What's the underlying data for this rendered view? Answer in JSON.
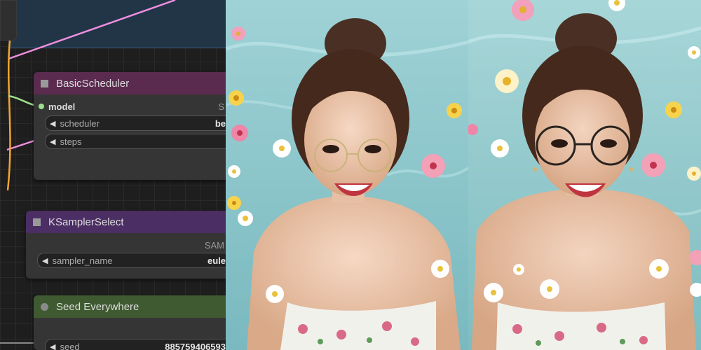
{
  "nodes": {
    "basic_scheduler": {
      "title": "BasicScheduler",
      "input_label": "model",
      "output_label": "S",
      "widgets": {
        "scheduler": {
          "label": "scheduler",
          "value": "be"
        },
        "steps": {
          "label": "steps",
          "value": ""
        }
      }
    },
    "ksampler_select": {
      "title": "KSamplerSelect",
      "output_label": "SAM",
      "widgets": {
        "sampler_name": {
          "label": "sampler_name",
          "value": "eule"
        }
      }
    },
    "seed_everywhere": {
      "title": "Seed Everywhere",
      "widgets": {
        "seed": {
          "label": "seed",
          "value": "885759406593"
        }
      }
    }
  },
  "colors": {
    "basic_scheduler_header": "#5a2b4f",
    "ksampler_select_header": "#4b2e63",
    "seed_everywhere_header": "#3f5a31",
    "wire_pink": "#f08fe0",
    "wire_orange": "#f2a533",
    "wire_green": "#9de08b",
    "group_bg": "#223547"
  },
  "images": [
    {
      "name": "girl-no-glasses-pool-photo",
      "icon": "portrait-photo"
    },
    {
      "name": "girl-round-glasses-pool-photo",
      "icon": "portrait-photo"
    }
  ]
}
